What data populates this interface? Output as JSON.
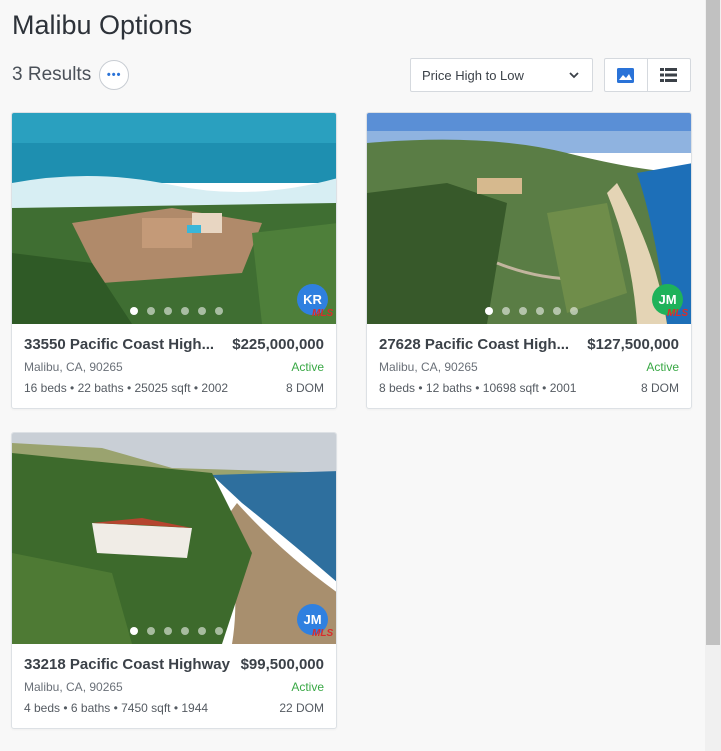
{
  "page": {
    "title": "Malibu Options",
    "results": "3 Results"
  },
  "toolbar": {
    "more_label": "•••",
    "sort_value": "Price High to Low",
    "view_modes": [
      "gallery-icon",
      "list-icon"
    ]
  },
  "colors": {
    "accent": "#2a73d8",
    "active": "#39a845",
    "mls": "#d92c2c"
  },
  "listings": [
    {
      "address": "33550 Pacific Coast High...",
      "price": "$225,000,000",
      "city": "Malibu, CA, 90265",
      "status": "Active",
      "details": "16 beds • 22 baths • 25025 sqft • 2002",
      "dom": "8 DOM",
      "agent": "KR",
      "agent_color": "#2f80e0",
      "mls": "MLS",
      "photo_count": 6,
      "photo_index": 1
    },
    {
      "address": "27628 Pacific Coast High...",
      "price": "$127,500,000",
      "city": "Malibu, CA, 90265",
      "status": "Active",
      "details": "8 beds • 12 baths • 10698 sqft • 2001",
      "dom": "8 DOM",
      "agent": "JM",
      "agent_color": "#1fb25a",
      "mls": "MLS",
      "photo_count": 6,
      "photo_index": 1
    },
    {
      "address": "33218 Pacific Coast Highway",
      "price": "$99,500,000",
      "city": "Malibu, CA, 90265",
      "status": "Active",
      "details": "4 beds • 6 baths • 7450 sqft • 1944",
      "dom": "22 DOM",
      "agent": "JM",
      "agent_color": "#2f80e0",
      "mls": "MLS",
      "photo_count": 6,
      "photo_index": 1
    }
  ]
}
